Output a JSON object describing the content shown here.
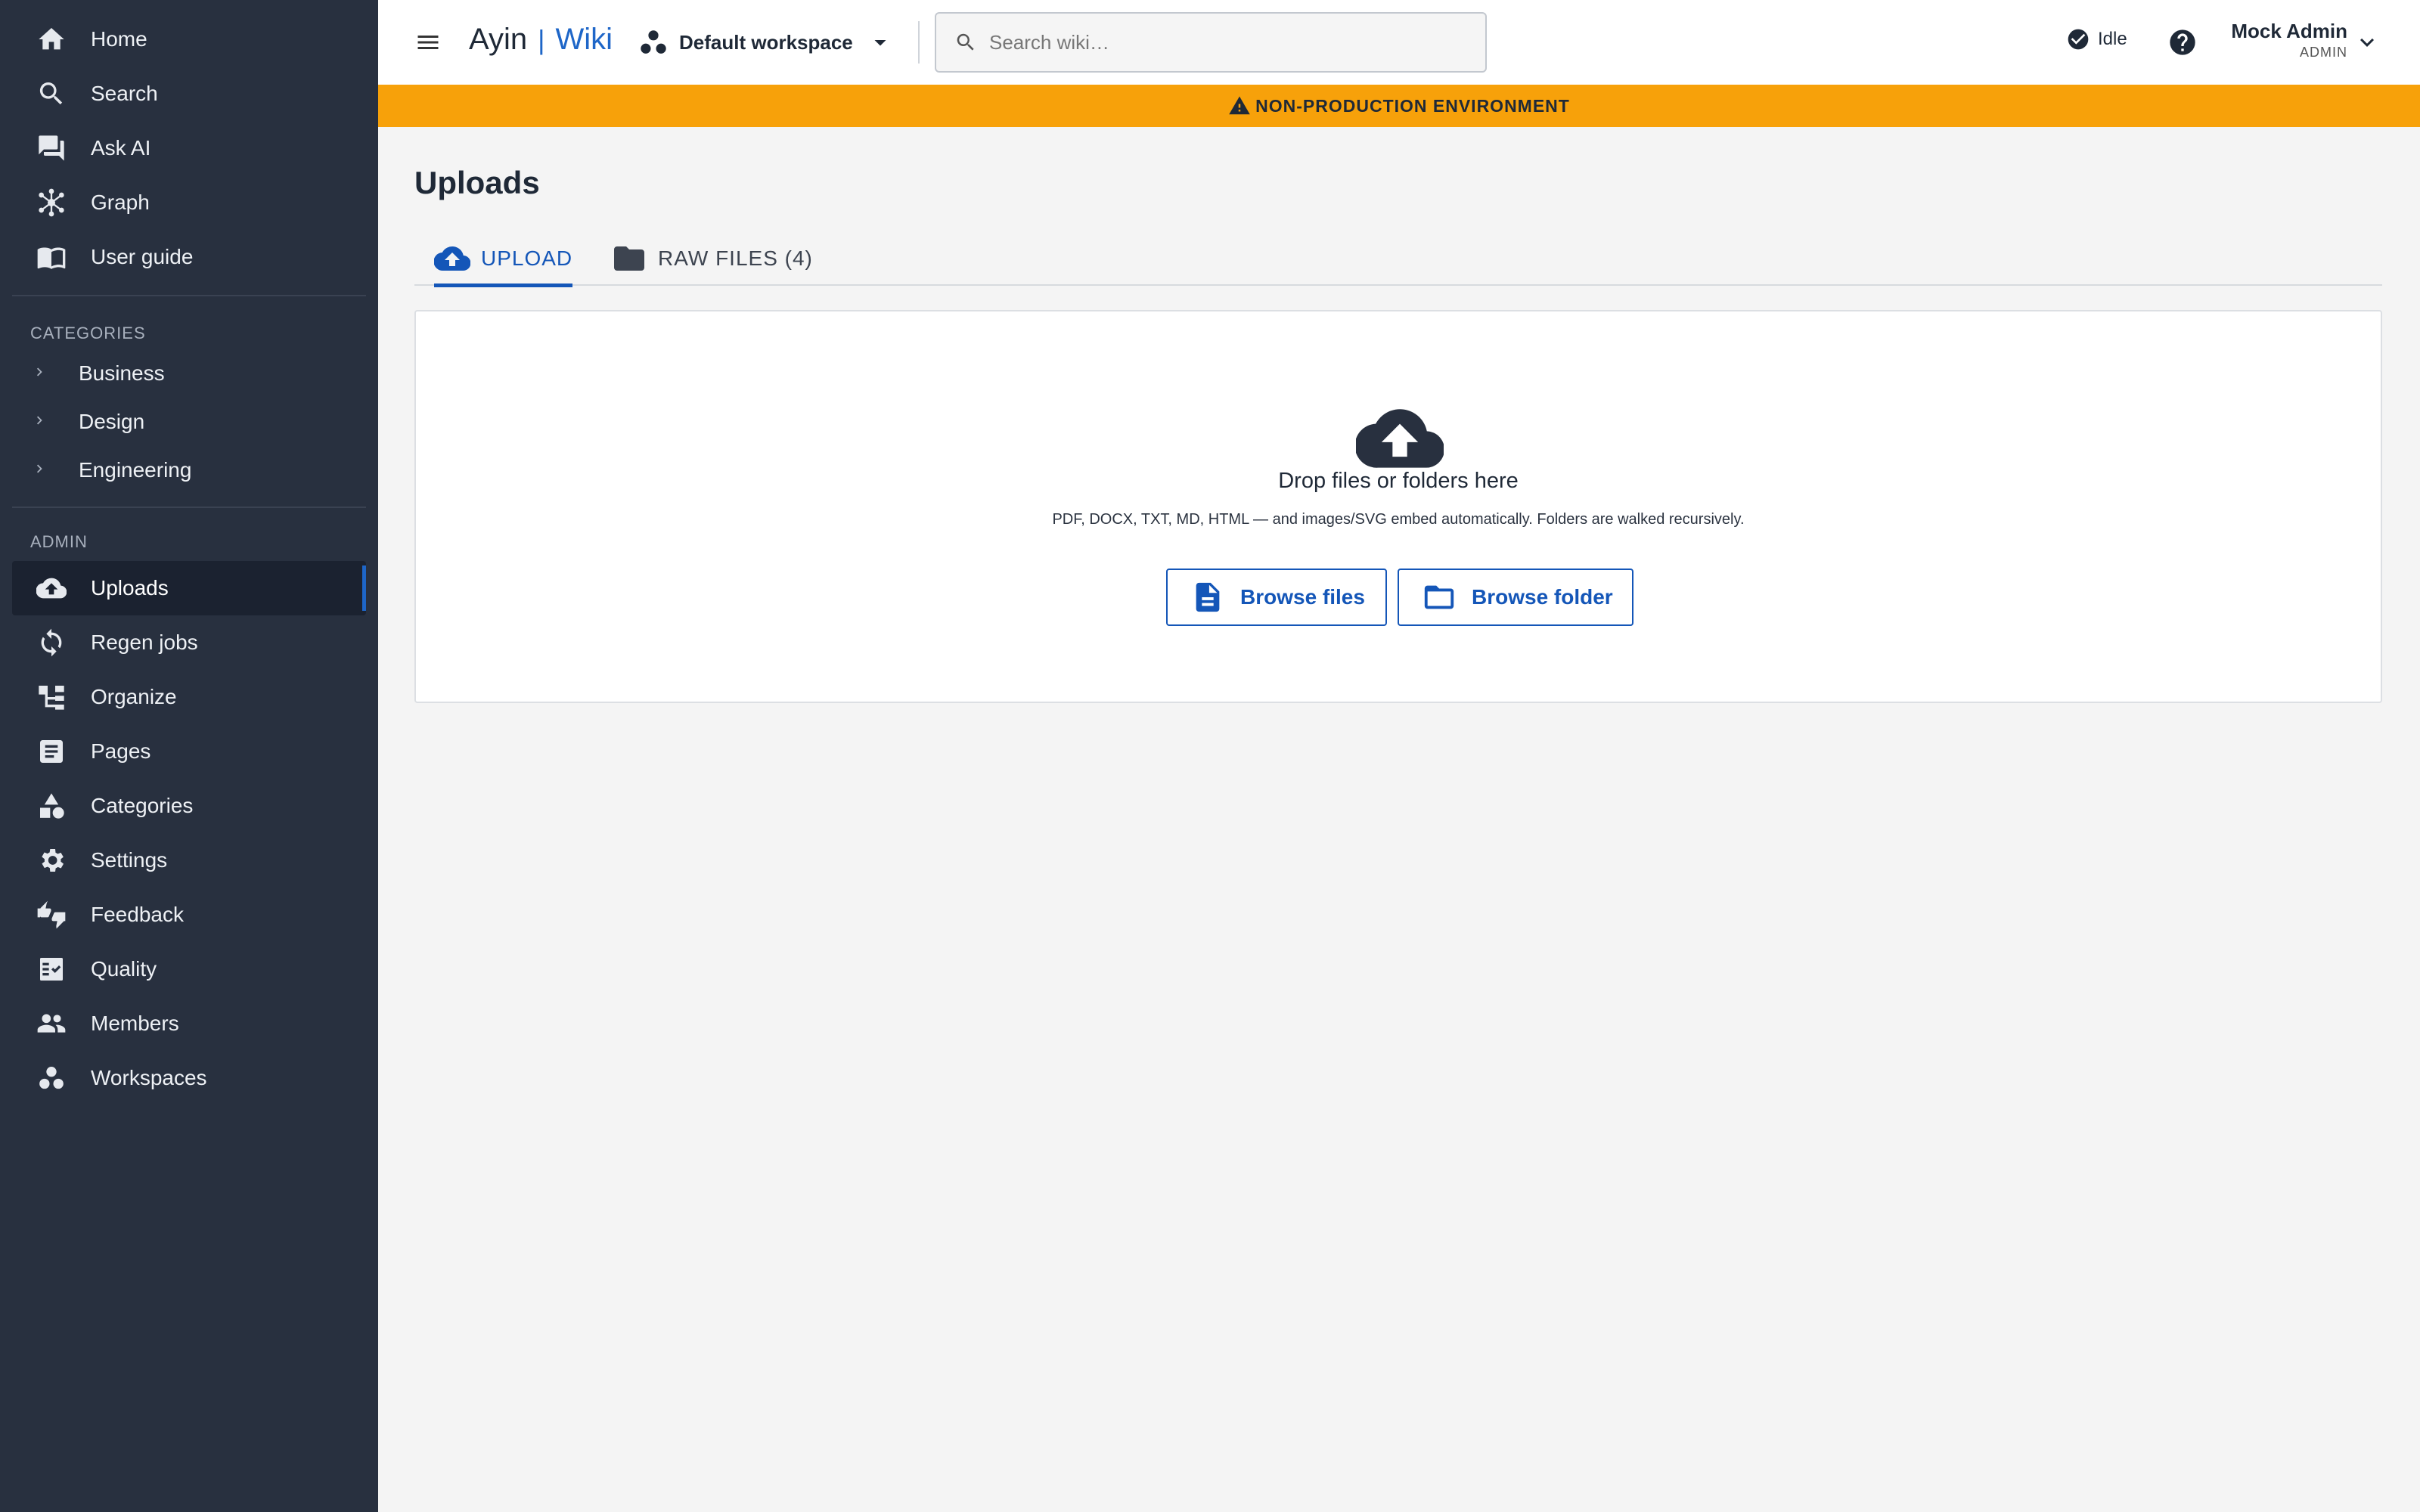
{
  "sidebar": {
    "nav": [
      {
        "label": "Home",
        "icon": "home-icon"
      },
      {
        "label": "Search",
        "icon": "search-icon"
      },
      {
        "label": "Ask AI",
        "icon": "chat-icon"
      },
      {
        "label": "Graph",
        "icon": "graph-icon"
      },
      {
        "label": "User guide",
        "icon": "book-icon"
      }
    ],
    "categories_title": "CATEGORIES",
    "categories": [
      {
        "label": "Business"
      },
      {
        "label": "Design"
      },
      {
        "label": "Engineering"
      }
    ],
    "admin_title": "ADMIN",
    "admin": [
      {
        "label": "Uploads",
        "icon": "cloud-upload-icon",
        "active": true
      },
      {
        "label": "Regen jobs",
        "icon": "refresh-icon"
      },
      {
        "label": "Organize",
        "icon": "organize-icon"
      },
      {
        "label": "Pages",
        "icon": "pages-icon"
      },
      {
        "label": "Categories",
        "icon": "categories-icon"
      },
      {
        "label": "Settings",
        "icon": "gear-icon"
      },
      {
        "label": "Feedback",
        "icon": "thumbs-icon"
      },
      {
        "label": "Quality",
        "icon": "checklist-icon"
      },
      {
        "label": "Members",
        "icon": "people-icon"
      },
      {
        "label": "Workspaces",
        "icon": "workspaces-icon"
      }
    ]
  },
  "header": {
    "brand_left": "Ayin",
    "brand_sep": "|",
    "brand_right": "Wiki",
    "workspace": "Default workspace",
    "search_placeholder": "Search wiki…",
    "status": "Idle",
    "user_name": "Mock Admin",
    "user_role": "ADMIN"
  },
  "banner": {
    "text": "NON-PRODUCTION ENVIRONMENT",
    "color": "#f7a10a"
  },
  "main": {
    "title": "Uploads",
    "tabs": [
      {
        "label": "UPLOAD",
        "icon": "cloud-upload-icon",
        "active": true
      },
      {
        "label": "RAW FILES (4)",
        "icon": "folder-icon",
        "active": false
      }
    ],
    "dropzone": {
      "title": "Drop files or folders here",
      "subtitle": "PDF, DOCX, TXT, MD, HTML — and images/SVG embed automatically. Folders are walked recursively.",
      "browse_files": "Browse files",
      "browse_folder": "Browse folder"
    }
  },
  "colors": {
    "sidebar_bg": "#28303f",
    "accent": "#1456b8",
    "active_item_bg": "#1b2230"
  }
}
